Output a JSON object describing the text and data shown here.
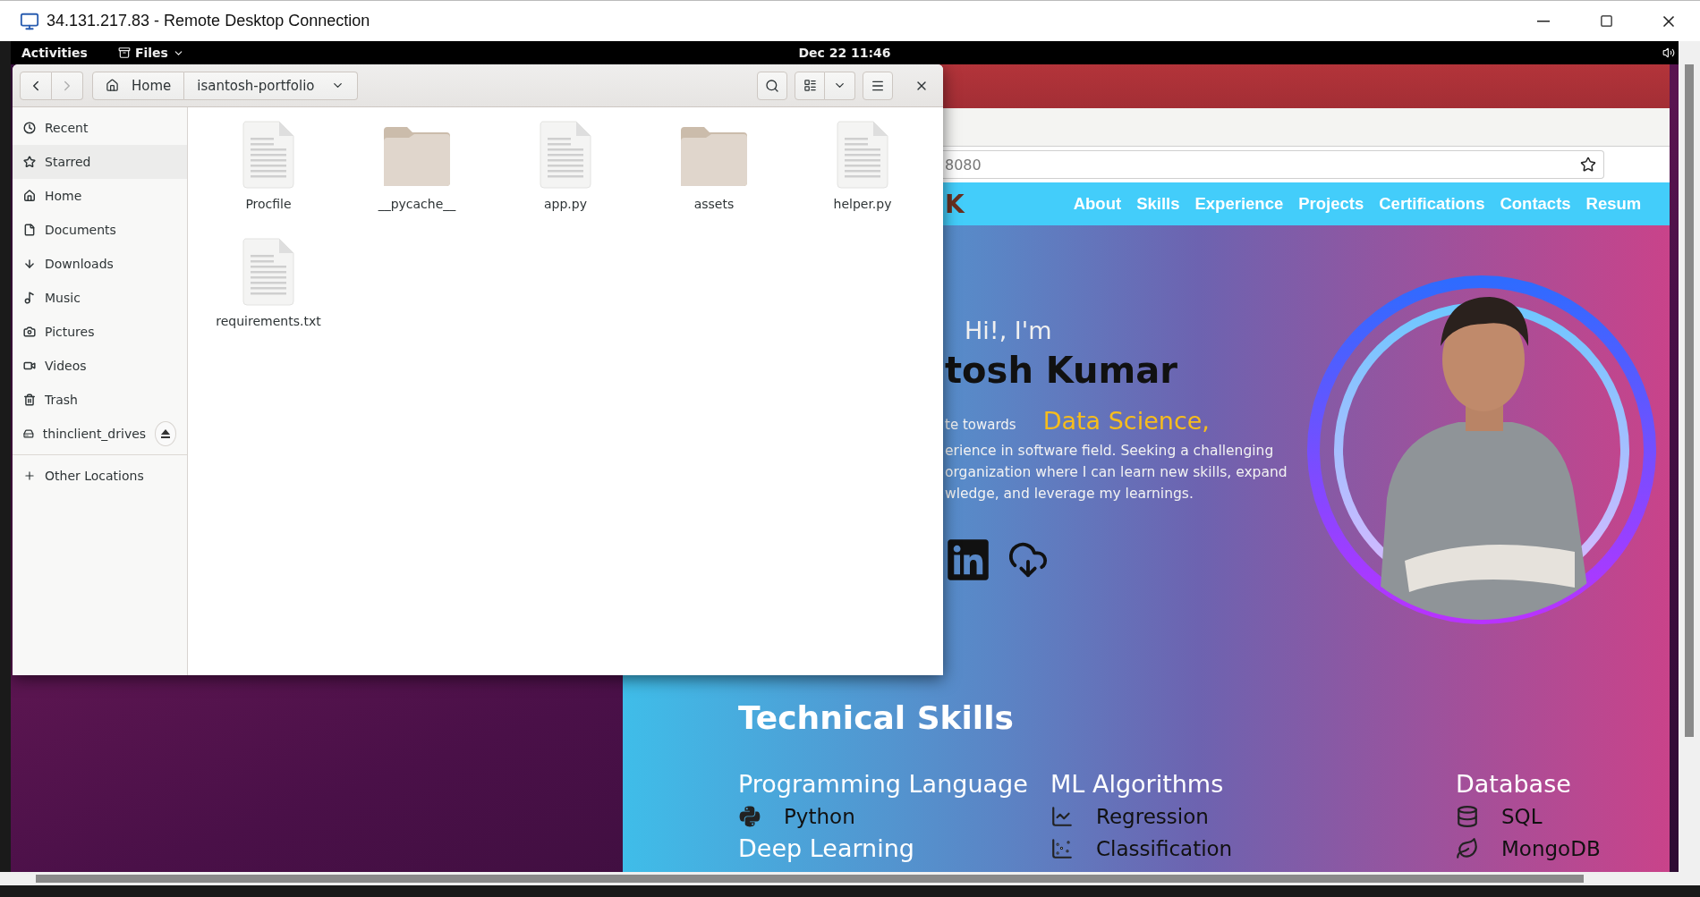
{
  "window": {
    "title": "34.131.217.83 - Remote Desktop Connection"
  },
  "top_bar": {
    "activities": "Activities",
    "app_menu": "Files",
    "clock": "Dec 22  11:46"
  },
  "files": {
    "nav": {
      "back_disabled": false,
      "forward_disabled": true
    },
    "path": [
      {
        "label": "Home",
        "kind": "home"
      },
      {
        "label": "isantosh-portfolio",
        "kind": "current"
      }
    ],
    "sidebar": {
      "items": [
        {
          "label": "Recent",
          "kind": "recent",
          "selected": false
        },
        {
          "label": "Starred",
          "kind": "starred",
          "selected": true
        },
        {
          "label": "Home",
          "kind": "home",
          "selected": false
        },
        {
          "label": "Documents",
          "kind": "documents",
          "selected": false
        },
        {
          "label": "Downloads",
          "kind": "downloads",
          "selected": false
        },
        {
          "label": "Music",
          "kind": "music",
          "selected": false
        },
        {
          "label": "Pictures",
          "kind": "pictures",
          "selected": false
        },
        {
          "label": "Videos",
          "kind": "videos",
          "selected": false
        },
        {
          "label": "Trash",
          "kind": "trash",
          "selected": false
        },
        {
          "label": "thinclient_drives",
          "kind": "drive",
          "selected": false
        }
      ],
      "other": {
        "label": "Other Locations"
      }
    },
    "items": [
      {
        "name": "Procfile",
        "kind": "file"
      },
      {
        "name": "__pycache__",
        "kind": "folder"
      },
      {
        "name": "app.py",
        "kind": "file"
      },
      {
        "name": "assets",
        "kind": "folder"
      },
      {
        "name": "helper.py",
        "kind": "file"
      },
      {
        "name": "requirements.txt",
        "kind": "file"
      }
    ]
  },
  "browser": {
    "url": "8080",
    "logo": "K",
    "nav": [
      "About",
      "Skills",
      "Experience",
      "Projects",
      "Certifications",
      "Contacts",
      "Resum"
    ],
    "hero": {
      "greeting": "Hi!, I'm",
      "name": "tosh Kumar",
      "tagline": "te towards",
      "highlight": "Data Science,",
      "description": [
        "erience in software field. Seeking a challenging",
        "organization where I can learn new skills, expand",
        "wledge, and leverage my learnings."
      ],
      "links": [
        {
          "kind": "linkedin"
        },
        {
          "kind": "download"
        }
      ]
    },
    "skills": {
      "title": "Technical Skills",
      "columns": [
        {
          "groups": [
            {
              "heading": "Programming Language",
              "items": [
                {
                  "label": "Python",
                  "kind": "python"
                }
              ]
            },
            {
              "heading": "Deep Learning"
            }
          ]
        },
        {
          "groups": [
            {
              "heading": "ML Algorithms",
              "items": [
                {
                  "label": "Regression",
                  "kind": "regression"
                },
                {
                  "label": "Classification",
                  "kind": "classification"
                }
              ]
            }
          ]
        },
        {
          "groups": [
            {
              "heading": "Database",
              "items": [
                {
                  "label": "SQL",
                  "kind": "sql"
                },
                {
                  "label": "MongoDB",
                  "kind": "mongodb"
                }
              ]
            }
          ]
        }
      ]
    }
  }
}
